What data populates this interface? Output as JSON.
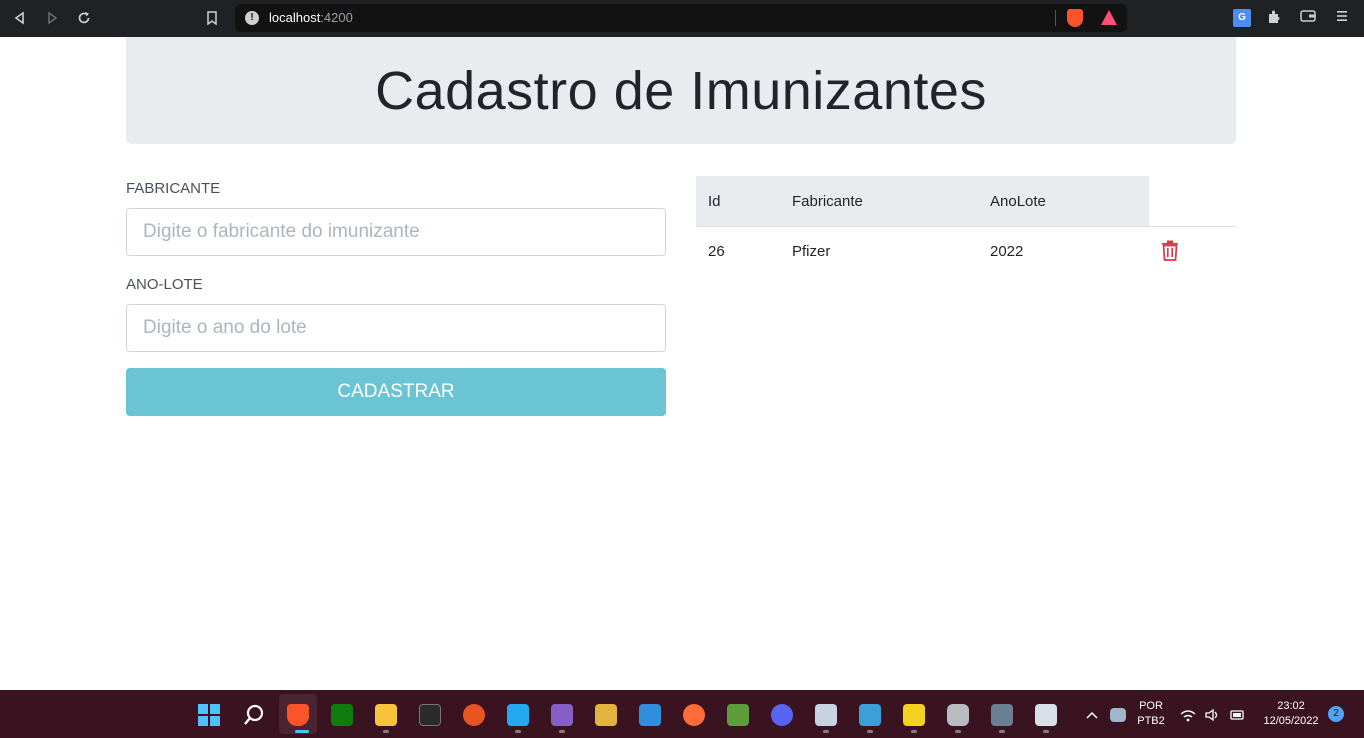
{
  "browser": {
    "url_host": "localhost",
    "url_port": ":4200",
    "icons": [
      "back-icon",
      "forward-icon",
      "reload-icon",
      "bookmark-icon",
      "site-info-icon",
      "brave-shields-icon",
      "brave-rewards-icon",
      "translate-icon",
      "extensions-icon",
      "wallet-icon",
      "menu-icon"
    ]
  },
  "page": {
    "title": "Cadastro de Imunizantes"
  },
  "form": {
    "fabricante_label": "FABRICANTE",
    "fabricante_placeholder": "Digite o fabricante do imunizante",
    "fabricante_value": "",
    "ano_lote_label": "ANO-LOTE",
    "ano_lote_placeholder": "Digite o ano do lote",
    "ano_lote_value": "",
    "submit_label": "CADASTRAR"
  },
  "table": {
    "headers": [
      "Id",
      "Fabricante",
      "AnoLote"
    ],
    "rows": [
      {
        "id": "26",
        "fabricante": "Pfizer",
        "ano_lote": "2022"
      }
    ]
  },
  "taskbar": {
    "language_line1": "POR",
    "language_line2": "PTB2",
    "time": "23:02",
    "date": "12/05/2022",
    "notification_count": "2"
  },
  "colors": {
    "button": "#6ac4d3",
    "jumbotron": "#e9ecef",
    "trash": "#dc3545",
    "taskbar": "#3a1320"
  }
}
